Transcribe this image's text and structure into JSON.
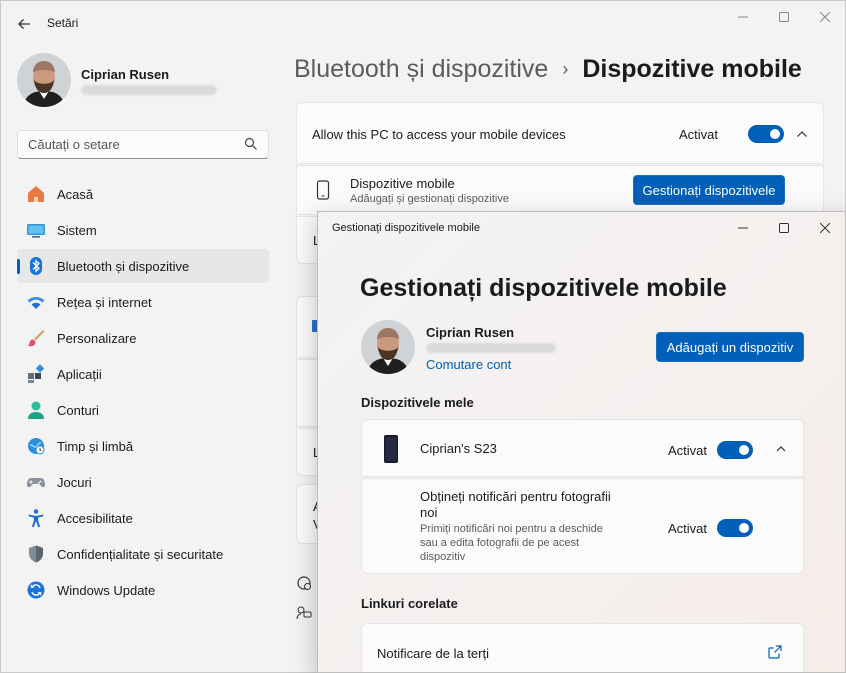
{
  "window": {
    "title": "Setări",
    "back_icon": "arrow-left-icon"
  },
  "profile": {
    "name": "Ciprian Rusen"
  },
  "search": {
    "placeholder": "Căutați o setare"
  },
  "sidebar": {
    "items": [
      {
        "label": "Acasă",
        "icon": "home-icon"
      },
      {
        "label": "Sistem",
        "icon": "system-icon"
      },
      {
        "label": "Bluetooth și dispozitive",
        "icon": "bluetooth-icon"
      },
      {
        "label": "Rețea și internet",
        "icon": "wifi-icon"
      },
      {
        "label": "Personalizare",
        "icon": "brush-icon"
      },
      {
        "label": "Aplicații",
        "icon": "apps-icon"
      },
      {
        "label": "Conturi",
        "icon": "person-icon"
      },
      {
        "label": "Timp și limbă",
        "icon": "globe-clock-icon"
      },
      {
        "label": "Jocuri",
        "icon": "gamepad-icon"
      },
      {
        "label": "Accesibilitate",
        "icon": "accessibility-icon"
      },
      {
        "label": "Confidențialitate și securitate",
        "icon": "shield-icon"
      },
      {
        "label": "Windows Update",
        "icon": "update-icon"
      }
    ],
    "active_index": 2
  },
  "breadcrumb": {
    "parent": "Bluetooth și dispozitive",
    "separator": "›",
    "current": "Dispozitive mobile"
  },
  "settings_panel": {
    "allow_label": "Allow this PC to access your mobile devices",
    "allow_state": "Activat",
    "mobile_title": "Dispozitive mobile",
    "mobile_subtitle": "Adăugați și gestionați dispozitive",
    "manage_button": "Gestionați dispozitivele",
    "partial_letters": [
      "L",
      "L",
      "A",
      "V"
    ]
  },
  "dialog": {
    "title": "Gestionați dispozitivele mobile",
    "heading": "Gestionați dispozitivele mobile",
    "account_name": "Ciprian Rusen",
    "switch_account": "Comutare cont",
    "add_device_button": "Adăugați un dispozitiv",
    "my_devices_title": "Dispozitivele mele",
    "device_name": "Ciprian's S23",
    "device_state": "Activat",
    "photo_notif_title": "Obțineți notificări pentru fotografii noi",
    "photo_notif_desc": "Primiți notificări noi pentru a deschide sau a edita fotografii de pe acest dispozitiv",
    "photo_notif_state": "Activat",
    "related_links_title": "Linkuri corelate",
    "third_party_link": "Notificare de la terți"
  },
  "colors": {
    "accent": "#005fb8",
    "window_bg": "#f3f3f3",
    "card_bg": "#fbfbfb"
  }
}
